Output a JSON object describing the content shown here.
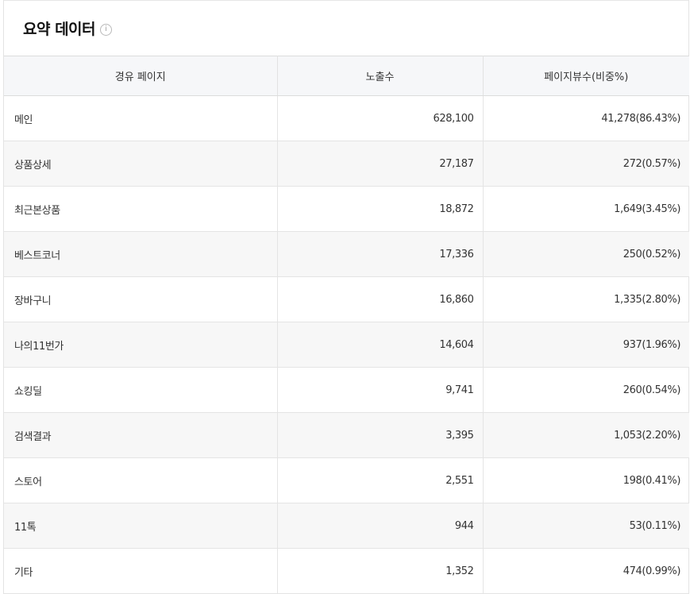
{
  "title": "요약 데이터",
  "info_icon": "info-icon",
  "columns": [
    "경유 페이지",
    "노출수",
    "페이지뷰수(비중%)"
  ],
  "rows": [
    {
      "page": "메인",
      "impressions": "628,100",
      "pageviews": "41,278(86.43%)"
    },
    {
      "page": "상품상세",
      "impressions": "27,187",
      "pageviews": "272(0.57%)"
    },
    {
      "page": "최근본상품",
      "impressions": "18,872",
      "pageviews": "1,649(3.45%)"
    },
    {
      "page": "베스트코너",
      "impressions": "17,336",
      "pageviews": "250(0.52%)"
    },
    {
      "page": "장바구니",
      "impressions": "16,860",
      "pageviews": "1,335(2.80%)"
    },
    {
      "page": "나의11번가",
      "impressions": "14,604",
      "pageviews": "937(1.96%)"
    },
    {
      "page": "쇼킹딜",
      "impressions": "9,741",
      "pageviews": "260(0.54%)"
    },
    {
      "page": "검색결과",
      "impressions": "3,395",
      "pageviews": "1,053(2.20%)"
    },
    {
      "page": "스토어",
      "impressions": "2,551",
      "pageviews": "198(0.41%)"
    },
    {
      "page": "11톡",
      "impressions": "944",
      "pageviews": "53(0.11%)"
    },
    {
      "page": "기타",
      "impressions": "1,352",
      "pageviews": "474(0.99%)"
    }
  ]
}
